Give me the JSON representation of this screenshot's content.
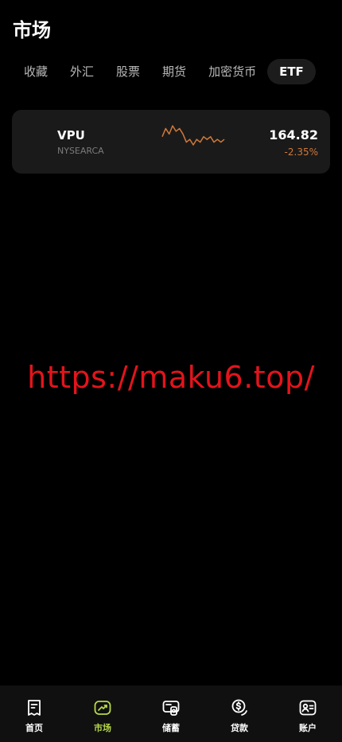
{
  "header": {
    "title": "市场"
  },
  "tabs": [
    {
      "label": "收藏",
      "active": false
    },
    {
      "label": "外汇",
      "active": false
    },
    {
      "label": "股票",
      "active": false
    },
    {
      "label": "期货",
      "active": false
    },
    {
      "label": "加密货币",
      "active": false
    },
    {
      "label": "ETF",
      "active": true
    }
  ],
  "quote": {
    "symbol": "VPU",
    "exchange": "NYSEARCA",
    "price": "164.82",
    "change": "-2.35%",
    "change_color": "#d0793a",
    "sparkline": [
      6,
      9,
      7,
      10,
      8,
      9,
      7,
      4,
      5,
      3,
      5,
      4,
      6,
      5,
      6,
      4,
      5,
      4,
      5
    ]
  },
  "watermark": {
    "text": "https://maku6.top/"
  },
  "nav": {
    "items": [
      {
        "label": "首页",
        "icon": "home-icon",
        "active": false
      },
      {
        "label": "市场",
        "icon": "market-icon",
        "active": true
      },
      {
        "label": "储蓄",
        "icon": "savings-icon",
        "active": false
      },
      {
        "label": "贷款",
        "icon": "loan-icon",
        "active": false
      },
      {
        "label": "账户",
        "icon": "account-icon",
        "active": false
      }
    ],
    "active_color": "#b7d84a"
  }
}
